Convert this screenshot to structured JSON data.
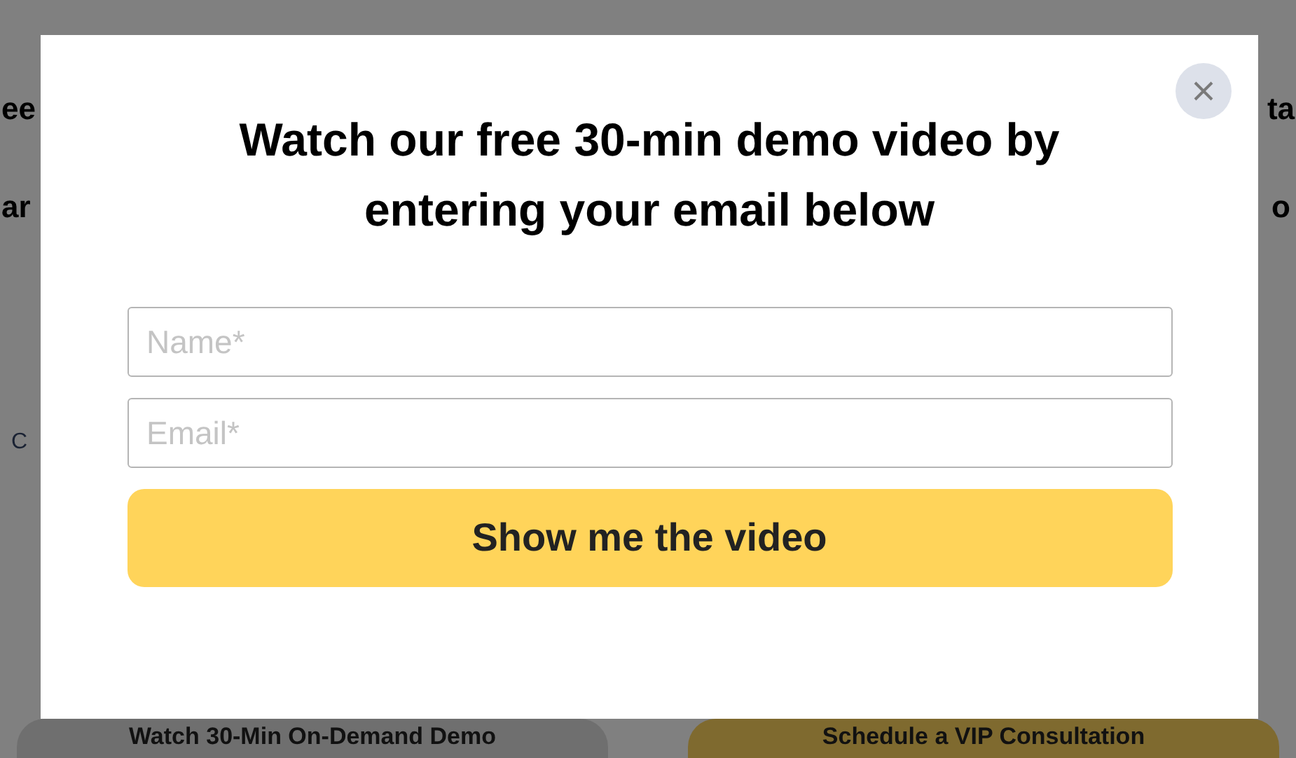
{
  "background_page": {
    "heading_line_1": {
      "left": "ee",
      "right": "ta"
    },
    "heading_line_2": {
      "left": "ar",
      "right": "o"
    },
    "fragment": "C",
    "buttons": [
      {
        "label": "Watch 30-Min On-Demand Demo",
        "kind": "secondary"
      },
      {
        "label": "Schedule a VIP Consultation",
        "kind": "primary"
      }
    ]
  },
  "modal": {
    "title": "Watch our free 30-min demo video by entering your email below",
    "fields": [
      {
        "placeholder": "Name*"
      },
      {
        "placeholder": "Email*"
      }
    ],
    "submit": "Show me the video"
  }
}
